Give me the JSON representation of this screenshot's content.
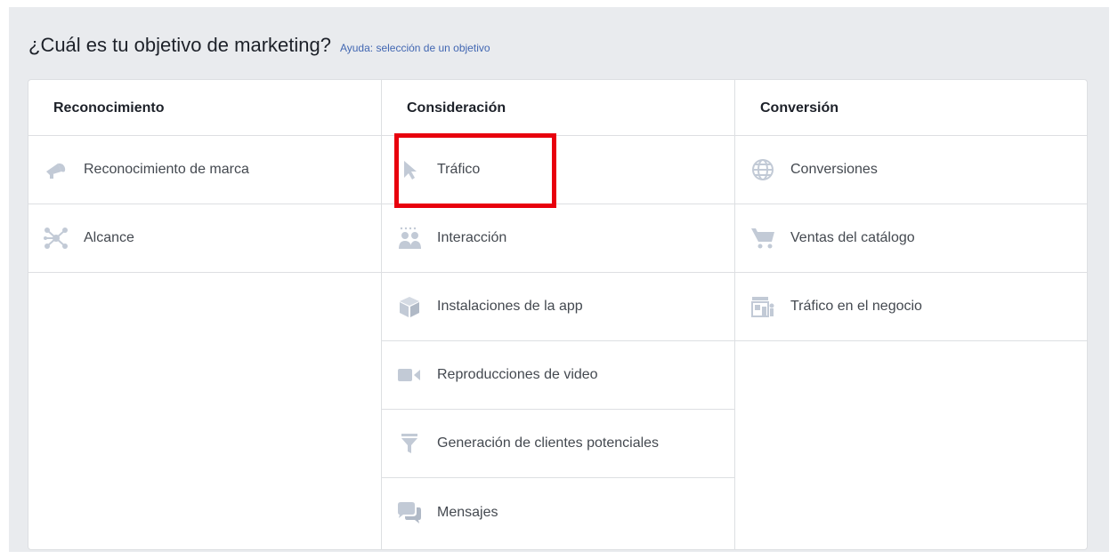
{
  "header": {
    "title": "¿Cuál es tu objetivo de marketing?",
    "help_link": "Ayuda: selección de un objetivo"
  },
  "columns": [
    {
      "title": "Reconocimiento",
      "items": [
        {
          "label": "Reconocimiento de marca",
          "icon": "megaphone-icon"
        },
        {
          "label": "Alcance",
          "icon": "network-icon"
        }
      ]
    },
    {
      "title": "Consideración",
      "items": [
        {
          "label": "Tráfico",
          "icon": "cursor-icon"
        },
        {
          "label": "Interacción",
          "icon": "people-icon"
        },
        {
          "label": "Instalaciones de la app",
          "icon": "box-icon"
        },
        {
          "label": "Reproducciones de video",
          "icon": "video-camera-icon"
        },
        {
          "label": "Generación de clientes potenciales",
          "icon": "funnel-icon"
        },
        {
          "label": "Mensajes",
          "icon": "chat-bubbles-icon"
        }
      ]
    },
    {
      "title": "Conversión",
      "items": [
        {
          "label": "Conversiones",
          "icon": "globe-icon"
        },
        {
          "label": "Ventas del catálogo",
          "icon": "shopping-cart-icon"
        },
        {
          "label": "Tráfico en el negocio",
          "icon": "store-icon"
        }
      ]
    }
  ],
  "colors": {
    "icon": "#c2cad6",
    "highlight": "#e8000d",
    "link": "#4267b2"
  }
}
